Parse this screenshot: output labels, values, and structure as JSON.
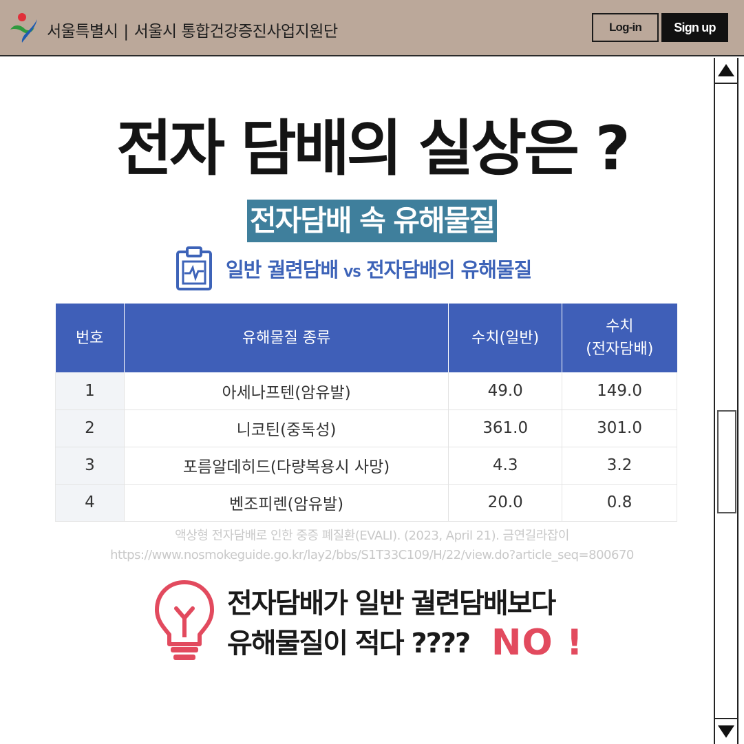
{
  "header": {
    "org_title": "서울특별시",
    "separator": "|",
    "org_subtitle": "서울시 통합건강증진사업지원단",
    "login_label": "Log-in",
    "signup_label": "Sign up"
  },
  "content": {
    "main_title": "전자 담배의 실상은 ?",
    "subtitle": "전자담배 속 유해물질",
    "comparison": {
      "left": "일반 궐련담배",
      "vs": "VS",
      "right": "전자담배의 유해물질"
    }
  },
  "table": {
    "headers": [
      "번호",
      "유해물질 종류",
      "수치(일반)",
      "수치",
      "(전자담배)"
    ],
    "rows": [
      [
        "1",
        "아세나프텐(암유발)",
        "49.0",
        "149.0"
      ],
      [
        "2",
        "니코틴(중독성)",
        "361.0",
        "301.0"
      ],
      [
        "3",
        "포름알데히드(다량복용시 사망)",
        "4.3",
        "3.2"
      ],
      [
        "4",
        "벤조피렌(암유발)",
        "20.0",
        "0.8"
      ]
    ]
  },
  "citation": {
    "line1": "액상형 전자담배로 인한 중증 폐질환(EVALI). (2023, April 21). 금연길라잡이",
    "line2": "https://www.nosmokeguide.go.kr/lay2/bbs/S1T33C109/H/22/view.do?article_seq=800670"
  },
  "conclusion": {
    "line1": "전자담배가 일반 궐련담배보다",
    "line2": "유해물질이 적다 ????",
    "no": "NO !"
  },
  "colors": {
    "header_bg": "#bba89a",
    "subtitle_bg": "#3f7f9c",
    "accent_blue": "#3d63b8",
    "table_header": "#3f5fb8",
    "no_red": "#e24a5e"
  }
}
